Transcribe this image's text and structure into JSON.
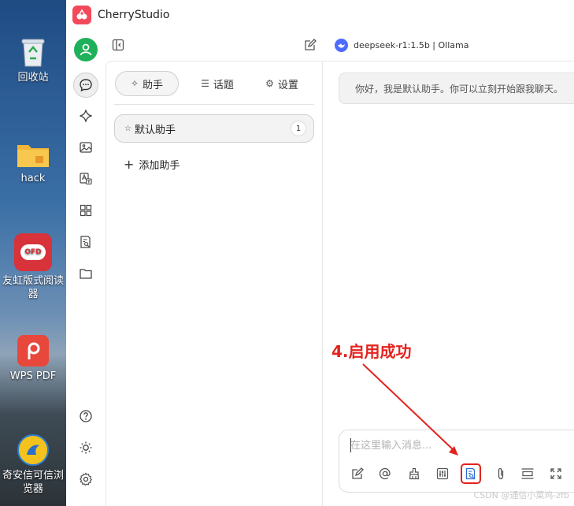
{
  "desktop": {
    "icons": [
      {
        "label": "回收站"
      },
      {
        "label": "hack"
      },
      {
        "label": "友虹版式阅读器"
      },
      {
        "label": "WPS PDF"
      },
      {
        "label": "奇安信可信浏览器"
      }
    ],
    "ofd_badge": "OFD"
  },
  "app": {
    "title": "CherryStudio",
    "model": "deepseek-r1:1.5b | Ollama",
    "accent": "#f24a5a"
  },
  "panel": {
    "tabs": [
      {
        "label": "助手",
        "icon": "sparkle-icon"
      },
      {
        "label": "话题",
        "icon": "list-icon"
      },
      {
        "label": "设置",
        "icon": "gear-icon"
      }
    ],
    "assistant": {
      "name": "默认助手",
      "count": "1"
    },
    "add_label": "添加助手"
  },
  "chat": {
    "welcome": "你好，我是默认助手。你可以立刻开始跟我聊天。",
    "placeholder": "在这里输入消息...",
    "annotation": "4.启用成功"
  },
  "watermark": "CSDN @通信小菜鸡-zfb",
  "colors": {
    "annotation": "#e3231e",
    "avatar": "#1fb05a"
  }
}
